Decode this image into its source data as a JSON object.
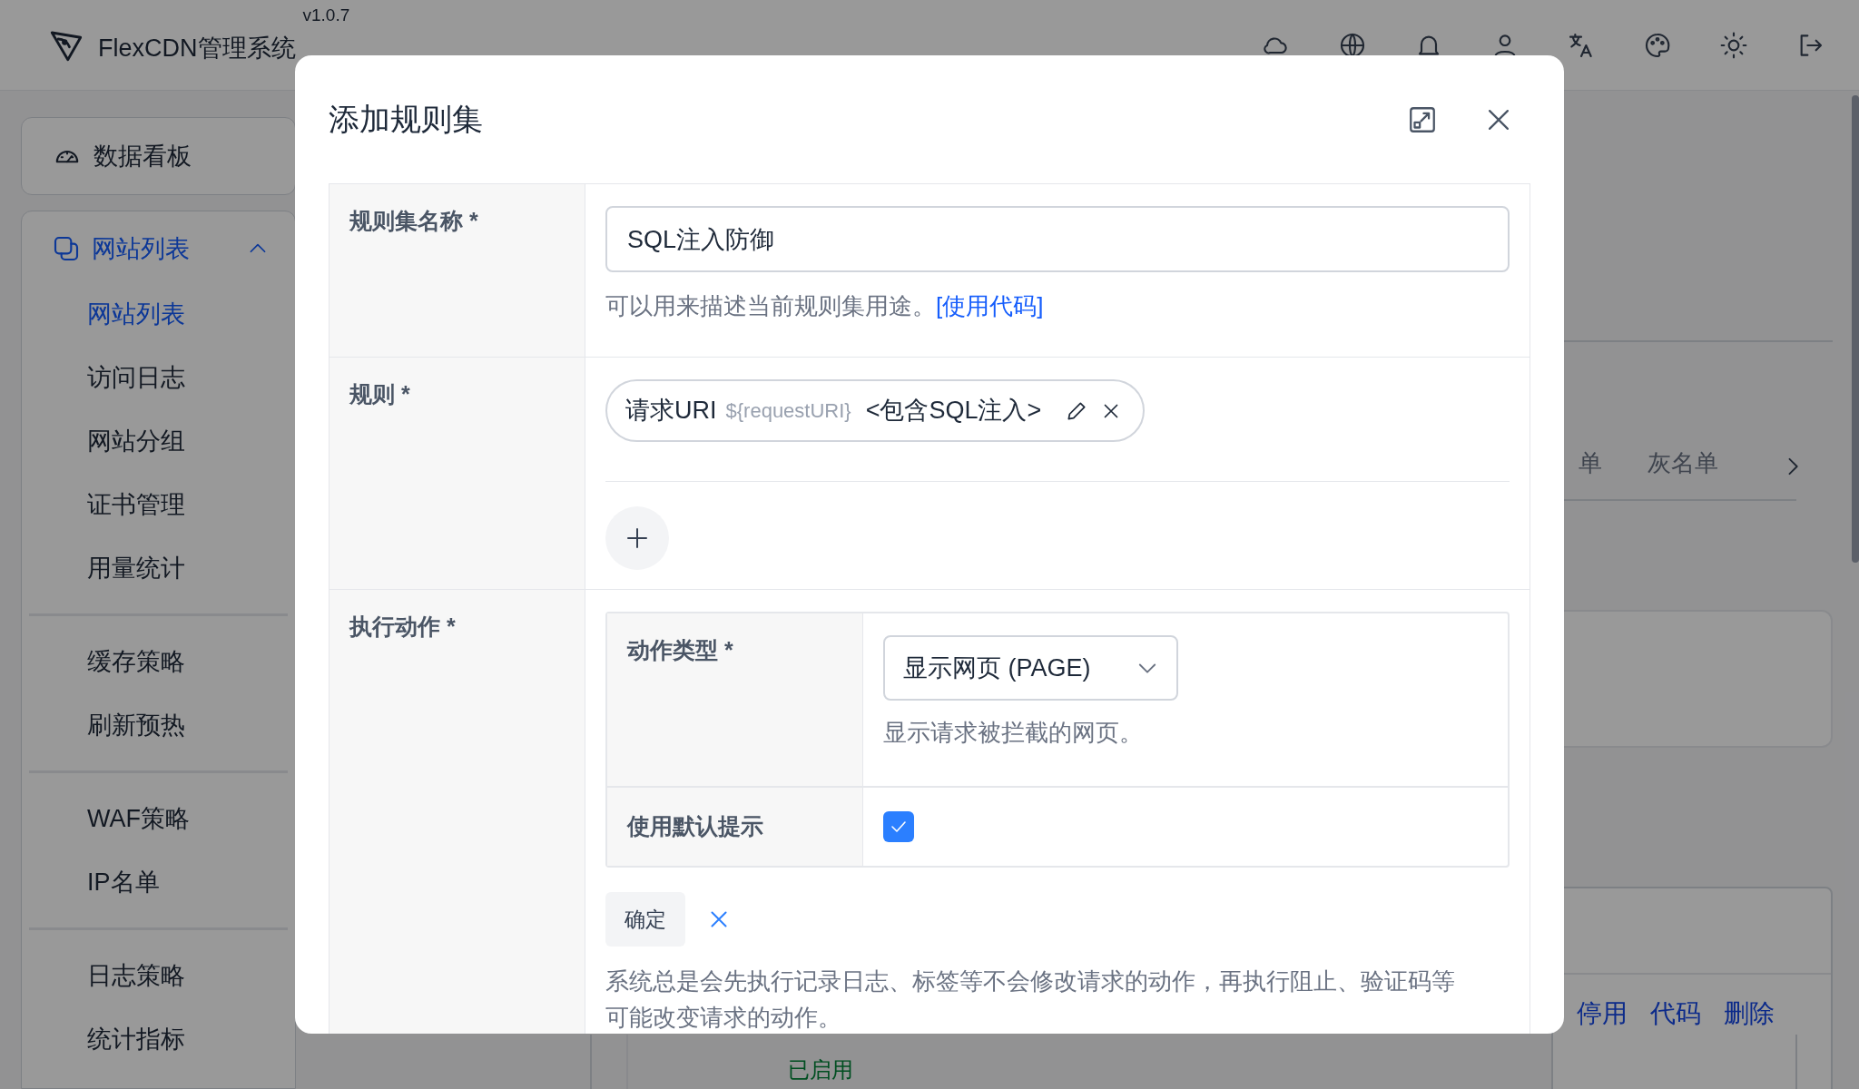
{
  "header": {
    "app_name": "FlexCDN管理系统",
    "version": "v1.0.7"
  },
  "sidebar": {
    "dashboard": {
      "label": "数据看板"
    },
    "section": {
      "label": "网站列表",
      "expanded": true,
      "groups": [
        {
          "items": [
            {
              "label": "网站列表",
              "selected": true
            },
            {
              "label": "访问日志",
              "selected": false
            },
            {
              "label": "网站分组",
              "selected": false
            },
            {
              "label": "证书管理",
              "selected": false
            },
            {
              "label": "用量统计",
              "selected": false
            }
          ]
        },
        {
          "items": [
            {
              "label": "缓存策略",
              "selected": false
            },
            {
              "label": "刷新预热",
              "selected": false
            }
          ]
        },
        {
          "items": [
            {
              "label": "WAF策略",
              "selected": false
            },
            {
              "label": "IP名单",
              "selected": false
            }
          ]
        },
        {
          "items": [
            {
              "label": "日志策略",
              "selected": false
            },
            {
              "label": "统计指标",
              "selected": false
            }
          ]
        }
      ]
    }
  },
  "background": {
    "tabs": [
      {
        "label": "单"
      },
      {
        "label": "灰名单"
      }
    ],
    "row_actions": [
      {
        "label": "停用"
      },
      {
        "label": "代码"
      },
      {
        "label": "删除"
      }
    ],
    "status": "已启用"
  },
  "dialog": {
    "title": "添加规则集",
    "rows": [
      {
        "kind": "text",
        "label": "规则集名称 *",
        "value": "SQL注入防御",
        "hint": "可以用来描述当前规则集用途。",
        "hint_link": "[使用代码]"
      },
      {
        "kind": "rules",
        "label": "规则 *",
        "rules": [
          {
            "name": "请求URI",
            "param": "${requestURI}",
            "operator": "<包含SQL注入>"
          }
        ]
      },
      {
        "kind": "action",
        "label": "执行动作 *",
        "fields": [
          {
            "kind": "select",
            "label": "动作类型 *",
            "value": "显示网页 (PAGE)",
            "hint": "显示请求被拦截的网页。"
          },
          {
            "kind": "checkbox",
            "label": "使用默认提示",
            "checked": true
          }
        ],
        "confirm": "确定",
        "note": "系统总是会先执行记录日志、标签等不会修改请求的动作，再执行阻止、验证码等可能改变请求的动作。"
      }
    ]
  }
}
